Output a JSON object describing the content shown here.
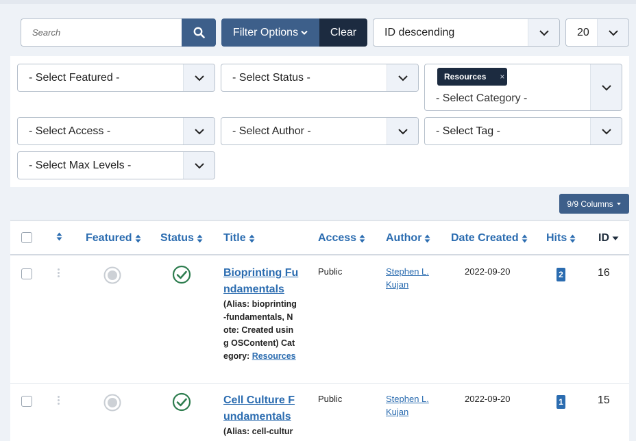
{
  "search": {
    "placeholder": "Search",
    "value": ""
  },
  "toolbar": {
    "filter_options_label": "Filter Options",
    "clear_label": "Clear",
    "ordering_value": "ID descending",
    "limit_value": "20"
  },
  "filters": {
    "featured": "- Select Featured -",
    "status": "- Select Status -",
    "category_chip": "Resources",
    "chip_remove": "×",
    "category": "- Select Category -",
    "access": "- Select Access -",
    "author": "- Select Author -",
    "tag": "- Select Tag -",
    "max_levels": "- Select Max Levels -"
  },
  "columns_button": "9/9 Columns",
  "table": {
    "headers": {
      "featured": "Featured",
      "status": "Status",
      "title": "Title",
      "access": "Access",
      "author": "Author",
      "date_created": "Date Created",
      "hits": "Hits",
      "id": "ID"
    },
    "rows": [
      {
        "title": "Bioprinting Fundamentals",
        "alias_note": "(Alias: bioprinting-fundamentals, Note: Created using OSContent)",
        "category_label": "Category:",
        "category": "Resources",
        "access": "Public",
        "author": "Stephen L. Kujan",
        "date_created": "2022-09-20",
        "hits": "2",
        "id": "16"
      },
      {
        "title": "Cell Culture Fundamentals",
        "alias_note": "(Alias: cell-culture",
        "access": "Public",
        "author": "Stephen L. Kujan",
        "date_created": "2022-09-20",
        "hits": "1",
        "id": "15"
      }
    ]
  },
  "colors": {
    "primary": "#3d5f8a",
    "dark": "#1c2b40",
    "link": "#2b6cb0",
    "published": "#2e7d4f"
  },
  "icons": {
    "search": "search-icon",
    "sort": "sort-icon",
    "chevron": "chevron-down-icon",
    "published": "check-circle-icon",
    "unfeatured": "circle-icon",
    "drag": "drag-handle-icon"
  }
}
